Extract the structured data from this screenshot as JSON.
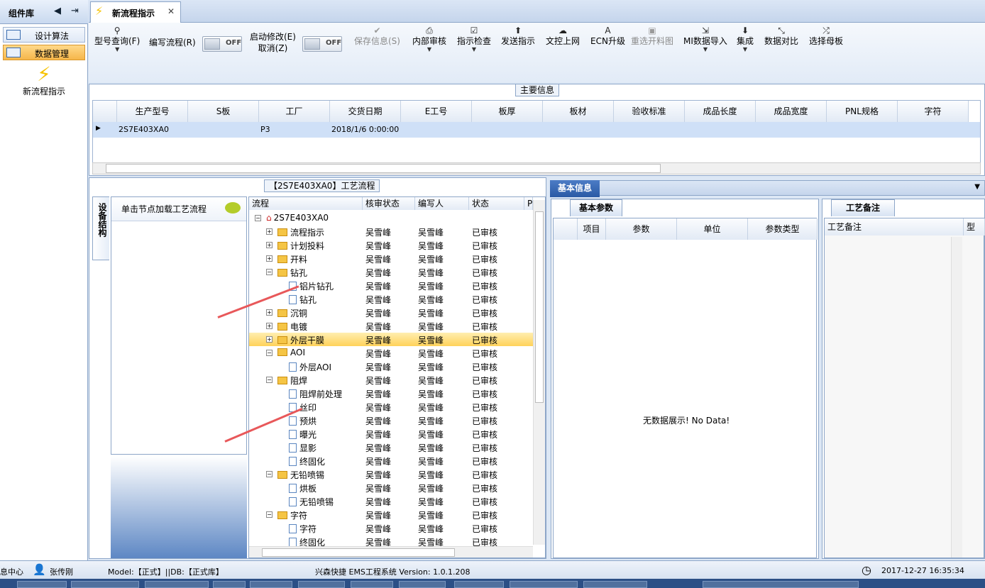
{
  "left_panel": {
    "title": "组件库",
    "items": [
      {
        "label": "设计算法"
      },
      {
        "label": "数据管理"
      }
    ],
    "flow_item": "新流程指示"
  },
  "tabs": [
    {
      "label": "新流程指示"
    }
  ],
  "toolbar": {
    "model_query": "型号查询(F)",
    "edit_flow": "编写流程(R)",
    "toggle1": "OFF",
    "enable_edit": "启动修改(E)",
    "cancel": "取消(Z)",
    "toggle2": "OFF",
    "save_info": "保存信息(S)",
    "internal_review": "内部审核",
    "check_instructions": "指示检查",
    "send_instructions": "发送指示",
    "upload_doc": "文控上网",
    "ecn_upgrade": "ECN升级",
    "reselect_cut": "重选开料图",
    "mi_import": "MI数据导入",
    "integrate": "集成",
    "data_compare": "数据对比",
    "select_master": "选择母板"
  },
  "main_info": {
    "label": "主要信息",
    "columns": [
      "生产型号",
      "S板",
      "工厂",
      "交货日期",
      "E工号",
      "板厚",
      "板材",
      "验收标准",
      "成品长度",
      "成品宽度",
      "PNL规格",
      "字符"
    ],
    "rows": [
      {
        "model": "2S7E403XA0",
        "factory": "P3",
        "date": "2018/1/6 0:00:00"
      }
    ]
  },
  "process": {
    "label": "【2S7E403XA0】工艺流程",
    "side_tab": "设备结构",
    "hint": "单击节点加载工艺流程",
    "columns": [
      "流程",
      "核审状态",
      "编写人",
      "状态",
      "Pl"
    ],
    "root": "2S7E403XA0",
    "nodes": [
      {
        "name": "流程指示",
        "level": 1,
        "folder": true,
        "expander": "+",
        "reviewer": "吴雪峰",
        "writer": "吴雪峰",
        "status": "已审核"
      },
      {
        "name": "计划投料",
        "level": 1,
        "folder": true,
        "expander": "+",
        "reviewer": "吴雪峰",
        "writer": "吴雪峰",
        "status": "已审核"
      },
      {
        "name": "开料",
        "level": 1,
        "folder": true,
        "expander": "+",
        "reviewer": "吴雪峰",
        "writer": "吴雪峰",
        "status": "已审核"
      },
      {
        "name": "钻孔",
        "level": 1,
        "folder": true,
        "expander": "−",
        "reviewer": "吴雪峰",
        "writer": "吴雪峰",
        "status": "已审核"
      },
      {
        "name": "铝片钻孔",
        "level": 2,
        "folder": false,
        "expander": "",
        "reviewer": "吴雪峰",
        "writer": "吴雪峰",
        "status": "已审核"
      },
      {
        "name": "钻孔",
        "level": 2,
        "folder": false,
        "expander": "",
        "reviewer": "吴雪峰",
        "writer": "吴雪峰",
        "status": "已审核"
      },
      {
        "name": "沉铜",
        "level": 1,
        "folder": true,
        "expander": "+",
        "reviewer": "吴雪峰",
        "writer": "吴雪峰",
        "status": "已审核"
      },
      {
        "name": "电镀",
        "level": 1,
        "folder": true,
        "expander": "+",
        "reviewer": "吴雪峰",
        "writer": "吴雪峰",
        "status": "已审核"
      },
      {
        "name": "外层干膜",
        "level": 1,
        "folder": true,
        "expander": "+",
        "reviewer": "吴雪峰",
        "writer": "吴雪峰",
        "status": "已审核",
        "selected": true
      },
      {
        "name": "AOI",
        "level": 1,
        "folder": true,
        "expander": "−",
        "reviewer": "吴雪峰",
        "writer": "吴雪峰",
        "status": "已审核"
      },
      {
        "name": "外层AOI",
        "level": 2,
        "folder": false,
        "expander": "",
        "reviewer": "吴雪峰",
        "writer": "吴雪峰",
        "status": "已审核"
      },
      {
        "name": "阻焊",
        "level": 1,
        "folder": true,
        "expander": "−",
        "reviewer": "吴雪峰",
        "writer": "吴雪峰",
        "status": "已审核"
      },
      {
        "name": "阻焊前处理",
        "level": 2,
        "folder": false,
        "expander": "",
        "reviewer": "吴雪峰",
        "writer": "吴雪峰",
        "status": "已审核"
      },
      {
        "name": "丝印",
        "level": 2,
        "folder": false,
        "expander": "",
        "reviewer": "吴雪峰",
        "writer": "吴雪峰",
        "status": "已审核"
      },
      {
        "name": "预烘",
        "level": 2,
        "folder": false,
        "expander": "",
        "reviewer": "吴雪峰",
        "writer": "吴雪峰",
        "status": "已审核"
      },
      {
        "name": "曝光",
        "level": 2,
        "folder": false,
        "expander": "",
        "reviewer": "吴雪峰",
        "writer": "吴雪峰",
        "status": "已审核"
      },
      {
        "name": "显影",
        "level": 2,
        "folder": false,
        "expander": "",
        "reviewer": "吴雪峰",
        "writer": "吴雪峰",
        "status": "已审核"
      },
      {
        "name": "终固化",
        "level": 2,
        "folder": false,
        "expander": "",
        "reviewer": "吴雪峰",
        "writer": "吴雪峰",
        "status": "已审核"
      },
      {
        "name": "无铅喷锡",
        "level": 1,
        "folder": true,
        "expander": "−",
        "reviewer": "吴雪峰",
        "writer": "吴雪峰",
        "status": "已审核"
      },
      {
        "name": "烘板",
        "level": 2,
        "folder": false,
        "expander": "",
        "reviewer": "吴雪峰",
        "writer": "吴雪峰",
        "status": "已审核"
      },
      {
        "name": "无铅喷锡",
        "level": 2,
        "folder": false,
        "expander": "",
        "reviewer": "吴雪峰",
        "writer": "吴雪峰",
        "status": "已审核"
      },
      {
        "name": "字符",
        "level": 1,
        "folder": true,
        "expander": "−",
        "reviewer": "吴雪峰",
        "writer": "吴雪峰",
        "status": "已审核"
      },
      {
        "name": "字符",
        "level": 2,
        "folder": false,
        "expander": "",
        "reviewer": "吴雪峰",
        "writer": "吴雪峰",
        "status": "已审核"
      },
      {
        "name": "终固化",
        "level": 2,
        "folder": false,
        "expander": "",
        "reviewer": "吴雪峰",
        "writer": "吴雪峰",
        "status": "已审核"
      }
    ]
  },
  "basic_info": {
    "tab": "基本信息",
    "params_tab": "基本参数",
    "columns": [
      "项目",
      "参数",
      "单位",
      "参数类型"
    ],
    "no_data": "无数据展示! No Data!",
    "notes_tab": "工艺备注",
    "notes_columns": [
      "工艺备注",
      "型"
    ]
  },
  "status_bar": {
    "message_center": "息中心",
    "user": "张传刚",
    "model_db": "Model:【正式】||DB:【正式库】",
    "app": "兴森快捷 EMS工程系统 Version: 1.0.1.208",
    "time": "2017-12-27 16:35:34"
  },
  "colors": {
    "selected_row": "#ffd25a",
    "accent": "#2a5aa5",
    "annotation_arrow": "#e8585a"
  }
}
